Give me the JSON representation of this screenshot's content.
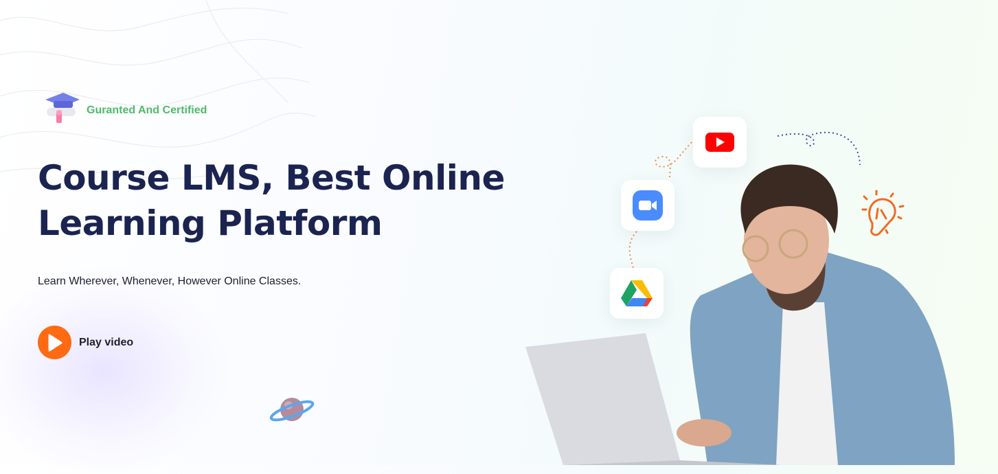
{
  "hero": {
    "badge_text": "Guranted And Certified",
    "title_line1": "Course LMS, Best Online",
    "title_line2": "Learning Platform",
    "subtitle": "Learn Wherever, Whenever, However Online Classes.",
    "play_label": "Play video"
  },
  "apps": [
    {
      "name": "youtube",
      "icon": "youtube-icon"
    },
    {
      "name": "zoom",
      "icon": "zoom-icon"
    },
    {
      "name": "google-drive",
      "icon": "google-drive-icon"
    }
  ],
  "colors": {
    "title": "#1b2450",
    "badge": "#4cbb6a",
    "accent": "#ff6a13"
  }
}
